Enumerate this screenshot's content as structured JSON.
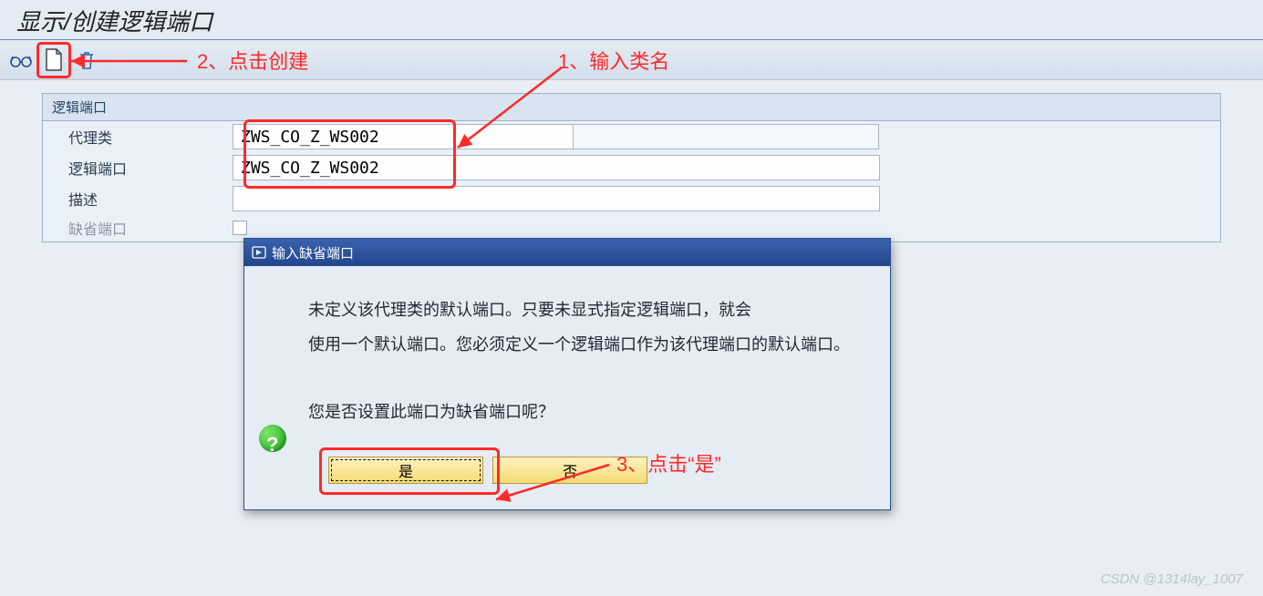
{
  "page": {
    "title": "显示/创建逻辑端口"
  },
  "toolbar": {
    "icons": [
      "glasses",
      "create",
      "trash"
    ]
  },
  "panel": {
    "title": "逻辑端口",
    "rows": {
      "proxy_class": {
        "label": "代理类",
        "value": "ZWS_CO_Z_WS002"
      },
      "logical_port": {
        "label": "逻辑端口",
        "value": "ZWS_CO_Z_WS002"
      },
      "description": {
        "label": "描述",
        "value": ""
      },
      "default_port": {
        "label": "缺省端口"
      }
    }
  },
  "dialog": {
    "title": "输入缺省端口",
    "line1": "未定义该代理类的默认端口。只要未显式指定逻辑端口，就会",
    "line2": "使用一个默认端口。您必须定义一个逻辑端口作为该代理端口的默认端口。",
    "question": "您是否设置此端口为缺省端口呢？",
    "yes": "是",
    "no": "否"
  },
  "annotations": {
    "a1": "1、输入类名",
    "a2": "2、点击创建",
    "a3": "3、点击“是”"
  },
  "watermark": "CSDN @1314lay_1007"
}
